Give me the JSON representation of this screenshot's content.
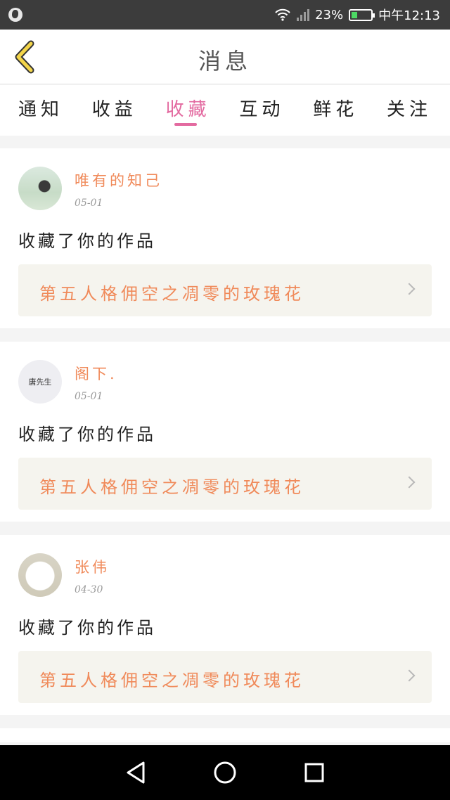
{
  "status_bar": {
    "battery": "23%",
    "time": "中午12:13"
  },
  "header": {
    "title": "消息"
  },
  "tabs": [
    {
      "label": "通知",
      "active": false
    },
    {
      "label": "收益",
      "active": false
    },
    {
      "label": "收藏",
      "active": true
    },
    {
      "label": "互动",
      "active": false
    },
    {
      "label": "鲜花",
      "active": false
    },
    {
      "label": "关注",
      "active": false
    }
  ],
  "messages": [
    {
      "user": "唯有的知己",
      "date": "05-01",
      "action": "收藏了你的作品",
      "work": "第五人格佣空之凋零的玫瑰花",
      "avatar_text": ""
    },
    {
      "user": "阁下.",
      "date": "05-01",
      "action": "收藏了你的作品",
      "work": "第五人格佣空之凋零的玫瑰花",
      "avatar_text": "唐先生"
    },
    {
      "user": "张伟",
      "date": "04-30",
      "action": "收藏了你的作品",
      "work": "第五人格佣空之凋零的玫瑰花",
      "avatar_text": ""
    }
  ],
  "colors": {
    "accent_tab": "#e36aa0",
    "accent_text": "#f08a5a",
    "back_arrow": "#f3d54a"
  },
  "icons": {
    "back": "chevron-left-icon",
    "nav": [
      "back-triangle-icon",
      "home-circle-icon",
      "recents-square-icon"
    ]
  }
}
